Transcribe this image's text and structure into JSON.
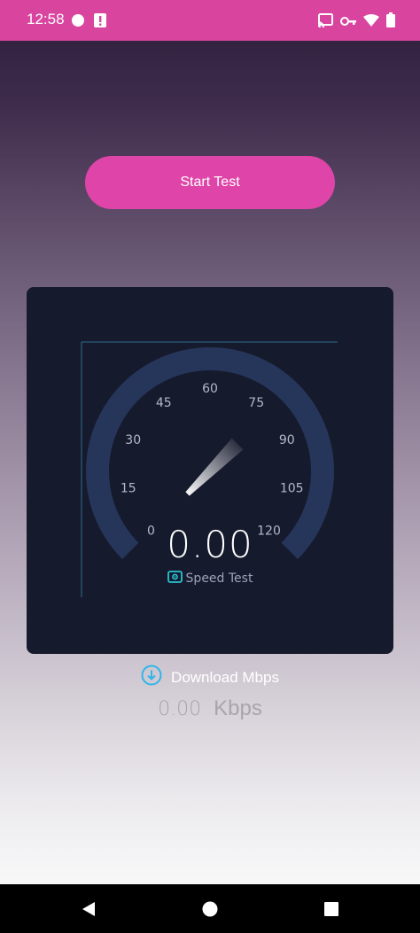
{
  "status_bar": {
    "time": "12:58",
    "left_icons": [
      "circle-app-icon",
      "alert-app-icon"
    ],
    "right_icons": [
      "cast-icon",
      "vpn-key-icon",
      "wifi-icon",
      "battery-icon"
    ]
  },
  "actions": {
    "start_label": "Start Test"
  },
  "gauge": {
    "value_text": "0.00",
    "min": 0,
    "max": 120,
    "current_value": 0,
    "tick_labels": [
      "0",
      "15",
      "30",
      "45",
      "60",
      "75",
      "90",
      "105",
      "120"
    ],
    "brand_label": "Speed Test"
  },
  "download": {
    "label": "Download Mbps",
    "value": "0.00",
    "unit": "Kbps"
  },
  "nav": {
    "buttons": [
      "back-icon",
      "home-icon",
      "recents-icon"
    ]
  },
  "colors": {
    "accent": "#df45a8",
    "status_bar": "#d9449f",
    "card": "#161a2d",
    "arc": "#26365a",
    "download_icon": "#2fb6ea"
  }
}
